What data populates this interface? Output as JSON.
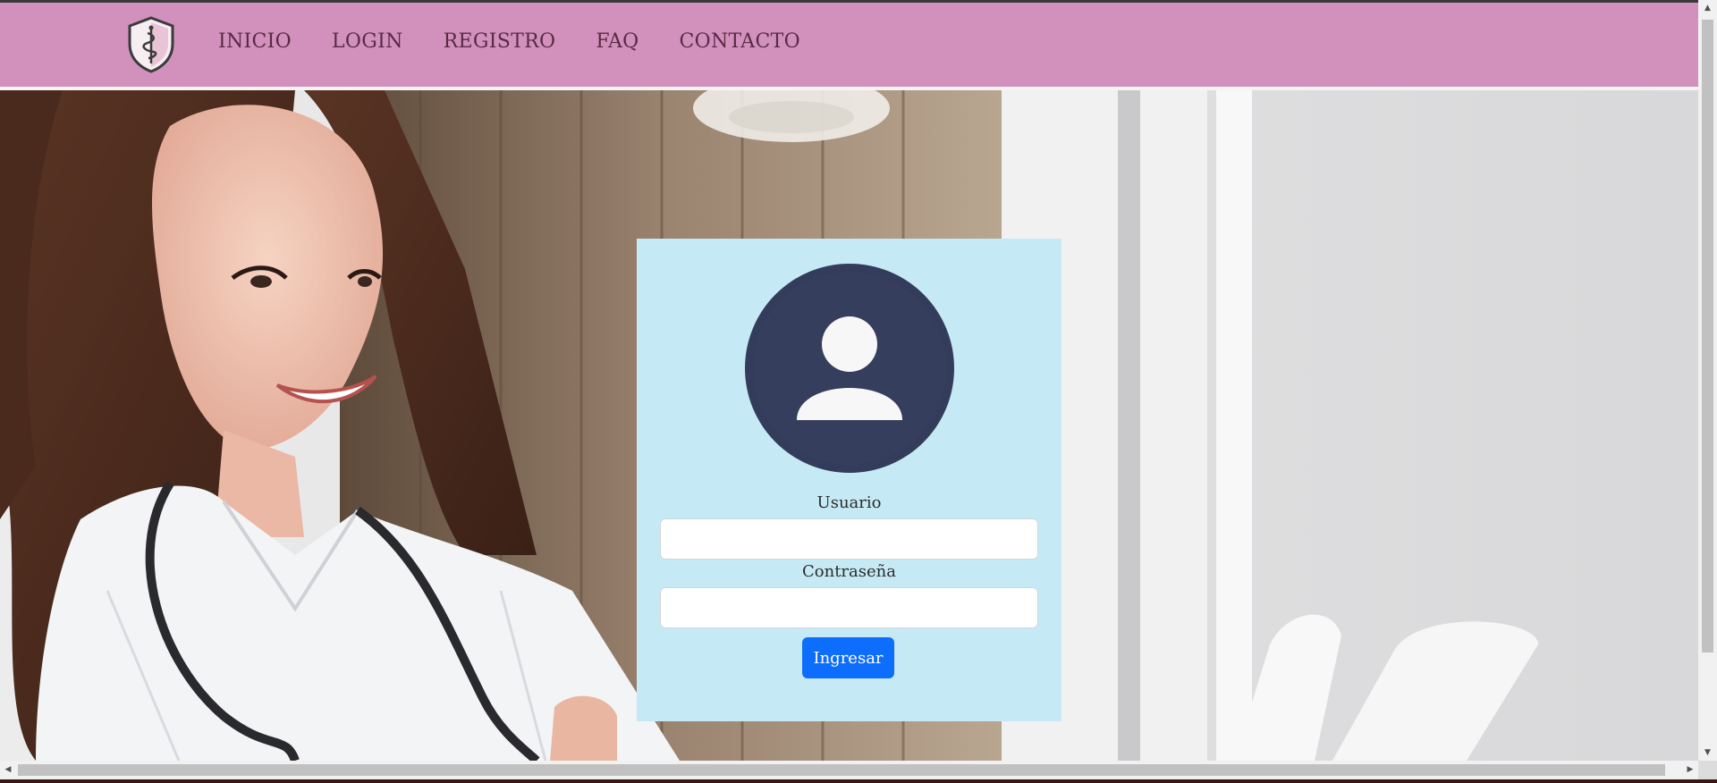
{
  "nav": {
    "logo_icon": "shield-caduceus-icon",
    "links": [
      {
        "label": "INICIO"
      },
      {
        "label": "LOGIN"
      },
      {
        "label": "REGISTRO"
      },
      {
        "label": "FAQ"
      },
      {
        "label": "CONTACTO"
      }
    ]
  },
  "hero": {
    "image": "smiling-doctor-with-stethoscope-photo"
  },
  "login": {
    "avatar_icon": "user-avatar-icon",
    "username_label": "Usuario",
    "username_value": "",
    "password_label": "Contraseña",
    "password_value": "",
    "submit_label": "Ingresar"
  },
  "colors": {
    "navbar": "#d291bc",
    "nav_text": "#5a2a45",
    "card": "#c6eaf5",
    "avatar_bg": "#333c5a",
    "button": "#0d6efd"
  }
}
